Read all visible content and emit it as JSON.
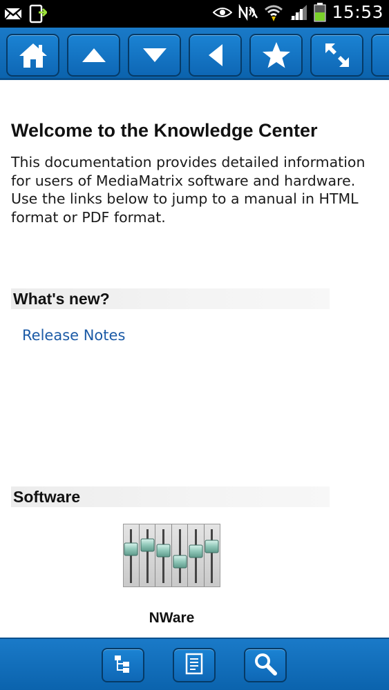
{
  "status_bar": {
    "time": "15:53",
    "icons": [
      "mail-icon",
      "download-icon",
      "eye-icon",
      "nfc-icon",
      "wifi-icon",
      "signal-icon",
      "battery-icon"
    ]
  },
  "toolbar": {
    "buttons": [
      {
        "name": "home",
        "icon": "home-icon"
      },
      {
        "name": "up",
        "icon": "arrow-up-icon"
      },
      {
        "name": "down",
        "icon": "arrow-down-icon"
      },
      {
        "name": "back",
        "icon": "arrow-left-icon"
      },
      {
        "name": "favorite",
        "icon": "star-icon"
      },
      {
        "name": "fullscreen",
        "icon": "expand-icon"
      }
    ]
  },
  "main": {
    "title": "Welcome to the Knowledge Center",
    "intro": "This documentation provides detailed information for users of MediaMatrix software and hardware. Use the links below to jump to a manual in HTML format or PDF format.",
    "sections": [
      {
        "heading": "What's new?",
        "links": [
          "Release Notes"
        ]
      },
      {
        "heading": "Software",
        "products": [
          {
            "label": "NWare",
            "icon": "mixer-faders-icon"
          }
        ]
      }
    ]
  },
  "bottom_bar": {
    "buttons": [
      {
        "name": "contents",
        "icon": "tree-icon"
      },
      {
        "name": "index",
        "icon": "document-icon"
      },
      {
        "name": "search",
        "icon": "search-icon"
      }
    ]
  },
  "colors": {
    "toolbar_blue": "#0e6dbd",
    "link_blue": "#1b5aa6",
    "status_bar": "#000000"
  }
}
